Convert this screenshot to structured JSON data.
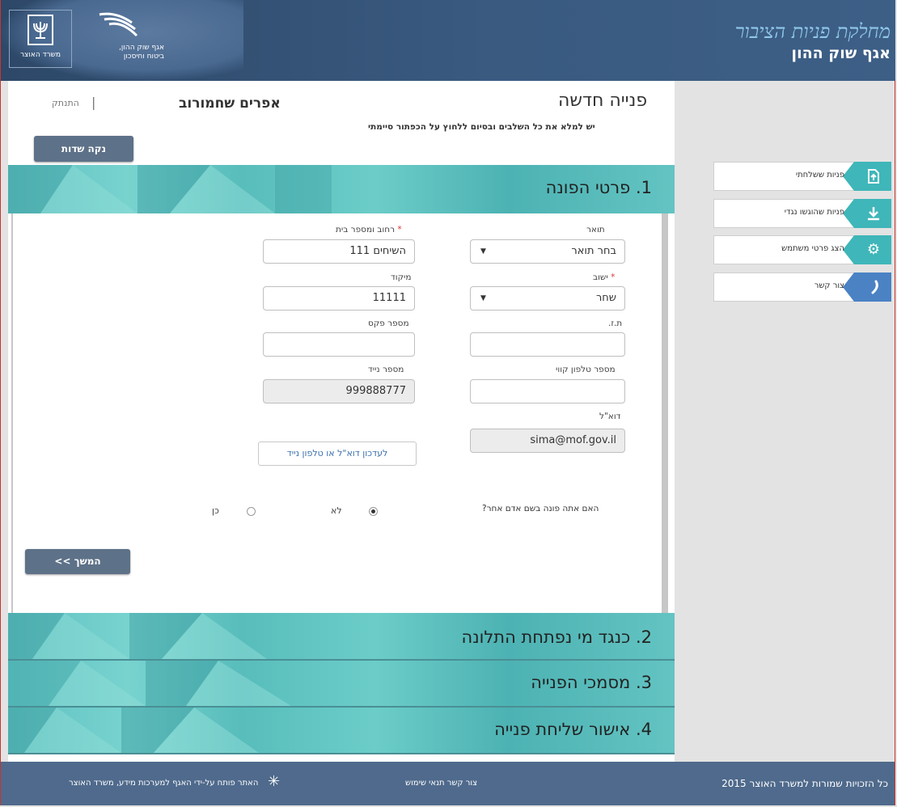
{
  "header": {
    "dept_title": "מחלקת פניות הציבור",
    "dept_subtitle": "אגף שוק ההון",
    "logo_mof_text": "משרד האוצר",
    "logo_cm_text": "אגף שוק ההון, ביטוח וחיסכון"
  },
  "user": {
    "name": "אפרים שחמורוב",
    "logout": "התנתק"
  },
  "page": {
    "title": "פנייה חדשה",
    "hint": "יש למלא את כל השלבים ובסיום ללחוץ על הכפתור סיימתי",
    "clear_button": "נקה שדות",
    "next_button": "המשך >>"
  },
  "sections": [
    {
      "label": "1. פרטי הפונה"
    },
    {
      "label": "2. כנגד מי נפתחת התלונה"
    },
    {
      "label": "3. מסמכי הפנייה"
    },
    {
      "label": "4. אישור שליחת פנייה"
    }
  ],
  "form": {
    "title_label": "תואר",
    "title_value": "בחר תואר",
    "street_label": "רחוב ומספר בית",
    "street_value": "השיחים 111",
    "city_label": "ישוב",
    "city_value": "שחר",
    "zip_label": "מיקוד",
    "zip_value": "11111",
    "id_label": "ת.ז.",
    "id_value": "",
    "fax_label": "מספר פקס",
    "fax_value": "",
    "phone_label": "מספר טלפון קווי",
    "phone_value": "",
    "mobile_label": "מספר נייד",
    "mobile_value": "999888777",
    "email_label": "דוא\"ל",
    "email_value": "sima@mof.gov.il",
    "update_button": "לעדכון דוא\"ל או טלפון נייד",
    "question": "האם אתה פונה בשם אדם אחר?",
    "opt_no": "לא",
    "opt_yes": "כן",
    "required_mark": "*"
  },
  "sidemenu": [
    {
      "label": "פניות ששלחתי",
      "icon": "upload-doc-icon",
      "color": "#3fb6b9"
    },
    {
      "label": "פניות שהוגשו נגדי",
      "icon": "download-icon",
      "color": "#3fb6b9"
    },
    {
      "label": "הצג פרטי משתמש",
      "icon": "gear-icon",
      "color": "#3fb6b9"
    },
    {
      "label": "צור קשר",
      "icon": "phone-icon",
      "color": "#4a82c4"
    }
  ],
  "footer": {
    "copyright": "כל הזכויות שמורות למשרד האוצר 2015",
    "links": "צור קשר  תנאי שימוש",
    "built_by": "האתר פותח על-ידי האגף למערכות מידע, משרד האוצר"
  },
  "colors": {
    "header": "#3a5a80",
    "section": "#5ec0c0",
    "button": "#5d7188",
    "footer": "#4f6a8c"
  }
}
